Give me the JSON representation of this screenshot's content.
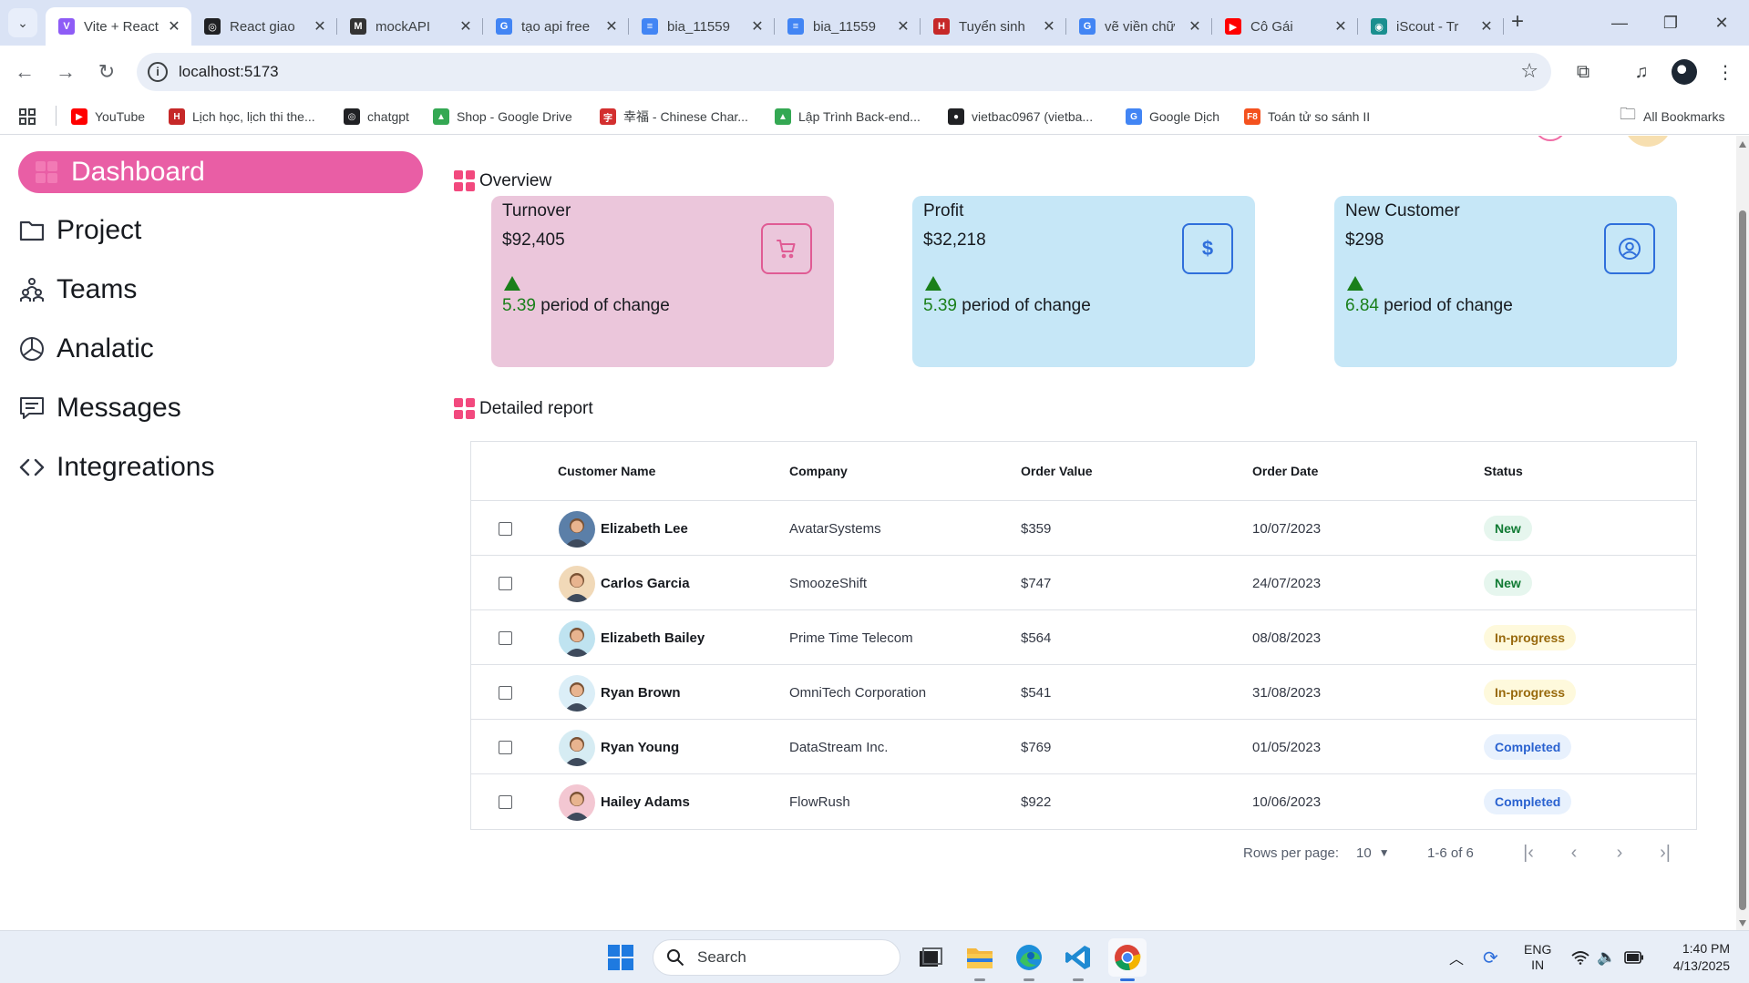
{
  "browser": {
    "tabs": [
      {
        "title": "Vite + React",
        "active": true,
        "favicon_color": "#8e5cf6",
        "favicon_glyph": "V"
      },
      {
        "title": "React giao",
        "active": false,
        "favicon_color": "#202124",
        "favicon_glyph": "◎"
      },
      {
        "title": "mockAPI",
        "active": false,
        "favicon_color": "#333333",
        "favicon_glyph": "M"
      },
      {
        "title": "tạo api free",
        "active": false,
        "favicon_color": "#4285f4",
        "favicon_glyph": "G"
      },
      {
        "title": "bia_11559",
        "active": false,
        "favicon_color": "#4285f4",
        "favicon_glyph": "≡"
      },
      {
        "title": "bia_11559",
        "active": false,
        "favicon_color": "#4285f4",
        "favicon_glyph": "≡"
      },
      {
        "title": "Tuyển sinh",
        "active": false,
        "favicon_color": "#c62828",
        "favicon_glyph": "H"
      },
      {
        "title": "vẽ viền chữ",
        "active": false,
        "favicon_color": "#4285f4",
        "favicon_glyph": "G"
      },
      {
        "title": "Cô Gái",
        "active": false,
        "favicon_color": "#ff0000",
        "favicon_glyph": "▶"
      },
      {
        "title": "iScout - Tr",
        "active": false,
        "favicon_color": "#1a8f8f",
        "favicon_glyph": "◉"
      }
    ],
    "url": "localhost:5173",
    "bookmarks": [
      {
        "label": "YouTube",
        "color": "#ff0000",
        "glyph": "▶"
      },
      {
        "label": "Lịch học, lịch thi the...",
        "color": "#c62828",
        "glyph": "H"
      },
      {
        "label": "chatgpt",
        "color": "#202124",
        "glyph": "◎"
      },
      {
        "label": "Shop - Google Drive",
        "color": "#34a853",
        "glyph": "▲"
      },
      {
        "label": "幸福 - Chinese Char...",
        "color": "#d32f2f",
        "glyph": "字"
      },
      {
        "label": "Lập Trình Back-end...",
        "color": "#34a853",
        "glyph": "▲"
      },
      {
        "label": "vietbac0967 (vietba...",
        "color": "#202124",
        "glyph": "●"
      },
      {
        "label": "Google Dịch",
        "color": "#4285f4",
        "glyph": "G"
      },
      {
        "label": "Toán tử so sánh II",
        "color": "#f4511e",
        "glyph": "F8"
      }
    ],
    "all_bookmarks_label": "All Bookmarks"
  },
  "sidebar": {
    "items": [
      {
        "label": "Dashboard",
        "icon": "dashboard-grid-icon",
        "active": true
      },
      {
        "label": "Project",
        "icon": "folder-icon",
        "active": false
      },
      {
        "label": "Teams",
        "icon": "people-icon",
        "active": false
      },
      {
        "label": "Analatic",
        "icon": "pie-chart-icon",
        "active": false
      },
      {
        "label": "Messages",
        "icon": "message-icon",
        "active": false
      },
      {
        "label": "Integreations",
        "icon": "code-icon",
        "active": false
      }
    ]
  },
  "overview": {
    "title": "Overview",
    "cards": [
      {
        "title": "Turnover",
        "value": "$92,405",
        "change": "5.39",
        "change_label": " period of change",
        "icon": "cart-icon",
        "bg": "#ebc6db",
        "accent": "#e05b94"
      },
      {
        "title": "Profit",
        "value": "$32,218",
        "change": "5.39",
        "change_label": " period of change",
        "icon": "dollar-icon",
        "bg": "#c6e7f7",
        "accent": "#2f6fdb"
      },
      {
        "title": "New Customer",
        "value": "$298",
        "change": "6.84",
        "change_label": " period of change",
        "icon": "user-icon",
        "bg": "#c6e7f7",
        "accent": "#2f6fdb"
      }
    ]
  },
  "report": {
    "title": "Detailed report",
    "columns": [
      "Customer Name",
      "Company",
      "Order Value",
      "Order Date",
      "Status"
    ],
    "rows": [
      {
        "name": "Elizabeth Lee",
        "company": "AvatarSystems",
        "value": "$359",
        "date": "10/07/2023",
        "status": "New",
        "avatar_bg": "#5b7fa8"
      },
      {
        "name": "Carlos Garcia",
        "company": "SmoozeShift",
        "value": "$747",
        "date": "24/07/2023",
        "status": "New",
        "avatar_bg": "#f1d9b8"
      },
      {
        "name": "Elizabeth Bailey",
        "company": "Prime Time Telecom",
        "value": "$564",
        "date": "08/08/2023",
        "status": "In-progress",
        "avatar_bg": "#bfe3f0"
      },
      {
        "name": "Ryan Brown",
        "company": "OmniTech Corporation",
        "value": "$541",
        "date": "31/08/2023",
        "status": "In-progress",
        "avatar_bg": "#dbeef7"
      },
      {
        "name": "Ryan Young",
        "company": "DataStream Inc.",
        "value": "$769",
        "date": "01/05/2023",
        "status": "Completed",
        "avatar_bg": "#d6ecf3"
      },
      {
        "name": "Hailey Adams",
        "company": "FlowRush",
        "value": "$922",
        "date": "10/06/2023",
        "status": "Completed",
        "avatar_bg": "#f3c7d2"
      }
    ],
    "status_styles": {
      "New": {
        "bg": "#e6f6ee",
        "fg": "#117b34"
      },
      "In-progress": {
        "bg": "#fef9dc",
        "fg": "#98690c"
      },
      "Completed": {
        "bg": "#e8f1fd",
        "fg": "#2a62d0"
      }
    },
    "pagination": {
      "rows_per_page_label": "Rows per page:",
      "rows_per_page_value": "10",
      "range": "1-6 of 6"
    }
  },
  "taskbar": {
    "search_placeholder": "Search",
    "lang_top": "ENG",
    "lang_bottom": "IN",
    "time": "1:40 PM",
    "date": "4/13/2025"
  }
}
